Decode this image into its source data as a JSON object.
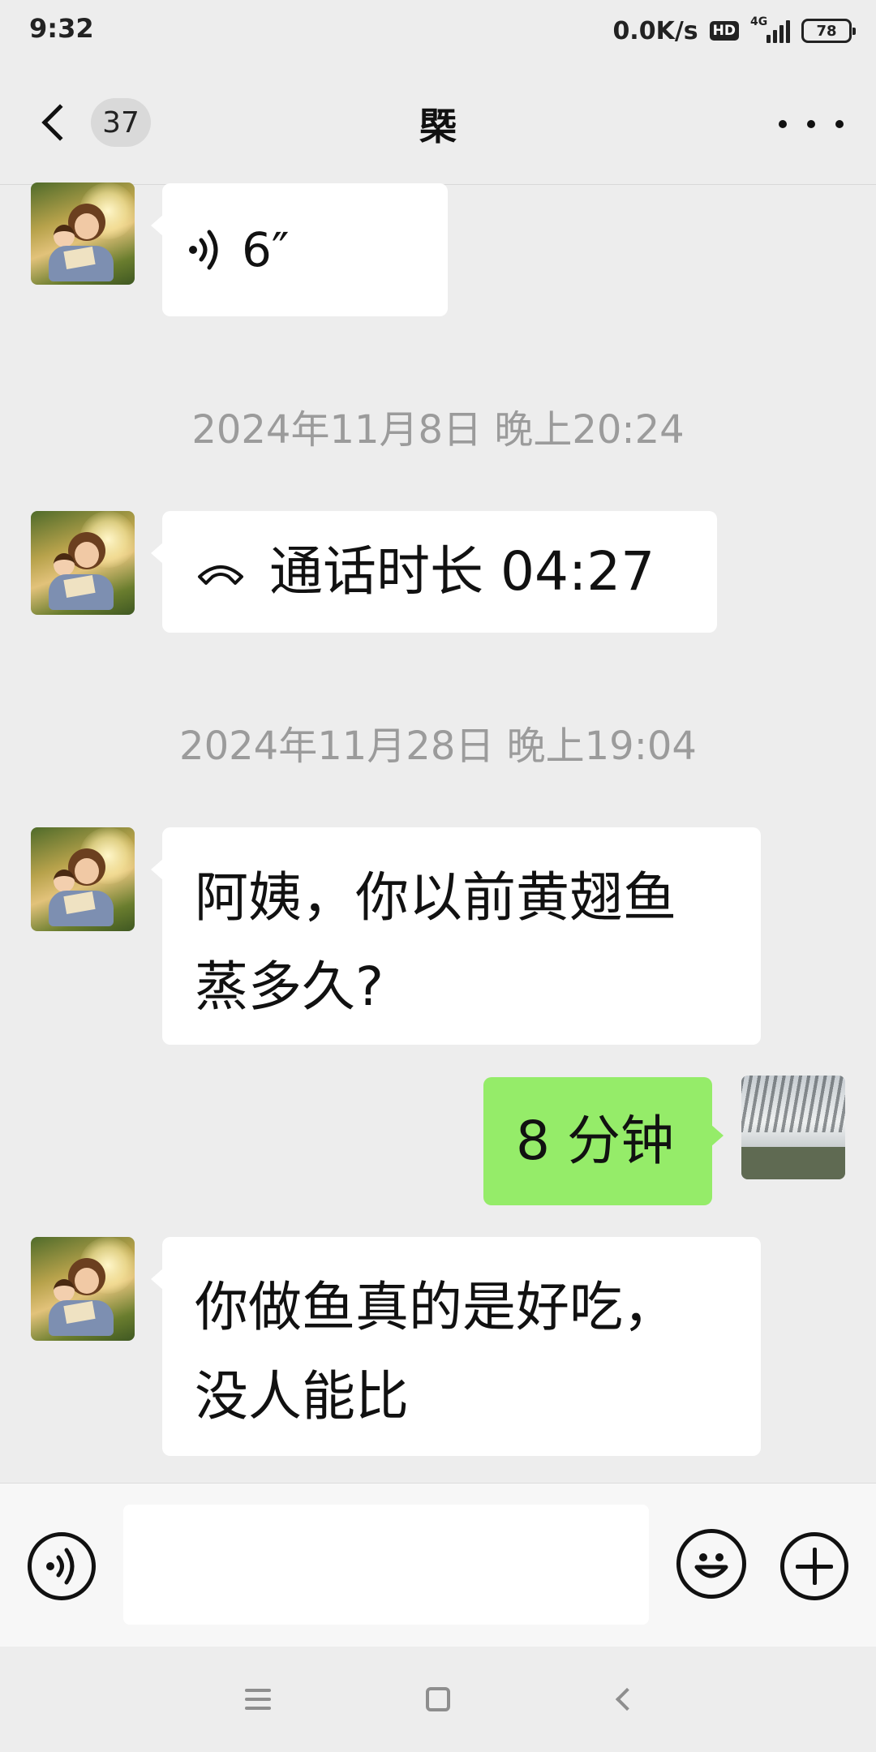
{
  "status_bar": {
    "time": "9:32",
    "net_speed": "0.0K/s",
    "hd_badge": "HD",
    "network_type": "4G",
    "battery": "78"
  },
  "header": {
    "unread_count": "37",
    "title": "槩",
    "back_icon": "chevron-left-icon",
    "more_icon": "more-horizontal-icon"
  },
  "messages": [
    {
      "sender": "other",
      "type": "voice",
      "duration": "6″",
      "icon": "voice-wave-icon"
    },
    {
      "type": "timestamp",
      "text": "2024年11月8日 晚上20:24"
    },
    {
      "sender": "other",
      "type": "call",
      "text": "通话时长 04:27",
      "icon": "phone-hangup-icon"
    },
    {
      "type": "timestamp",
      "text": "2024年11月28日 晚上19:04"
    },
    {
      "sender": "other",
      "type": "text",
      "lines": [
        "阿姨，你以前黄翅鱼",
        "蒸多久?"
      ]
    },
    {
      "sender": "me",
      "type": "text",
      "text": "8 分钟"
    },
    {
      "sender": "other",
      "type": "text",
      "lines": [
        "你做鱼真的是好吃，",
        "没人能比"
      ]
    }
  ],
  "input_bar": {
    "placeholder": "",
    "voice_icon": "voice-input-icon",
    "emoji_icon": "emoji-icon",
    "plus_icon": "plus-icon"
  },
  "system_nav": {
    "menu_icon": "menu-icon",
    "home_icon": "home-icon",
    "back_icon": "back-icon"
  },
  "colors": {
    "background": "#ededed",
    "bubble_in": "#ffffff",
    "bubble_out": "#95ec69",
    "timestamp": "#9b9b9b"
  }
}
